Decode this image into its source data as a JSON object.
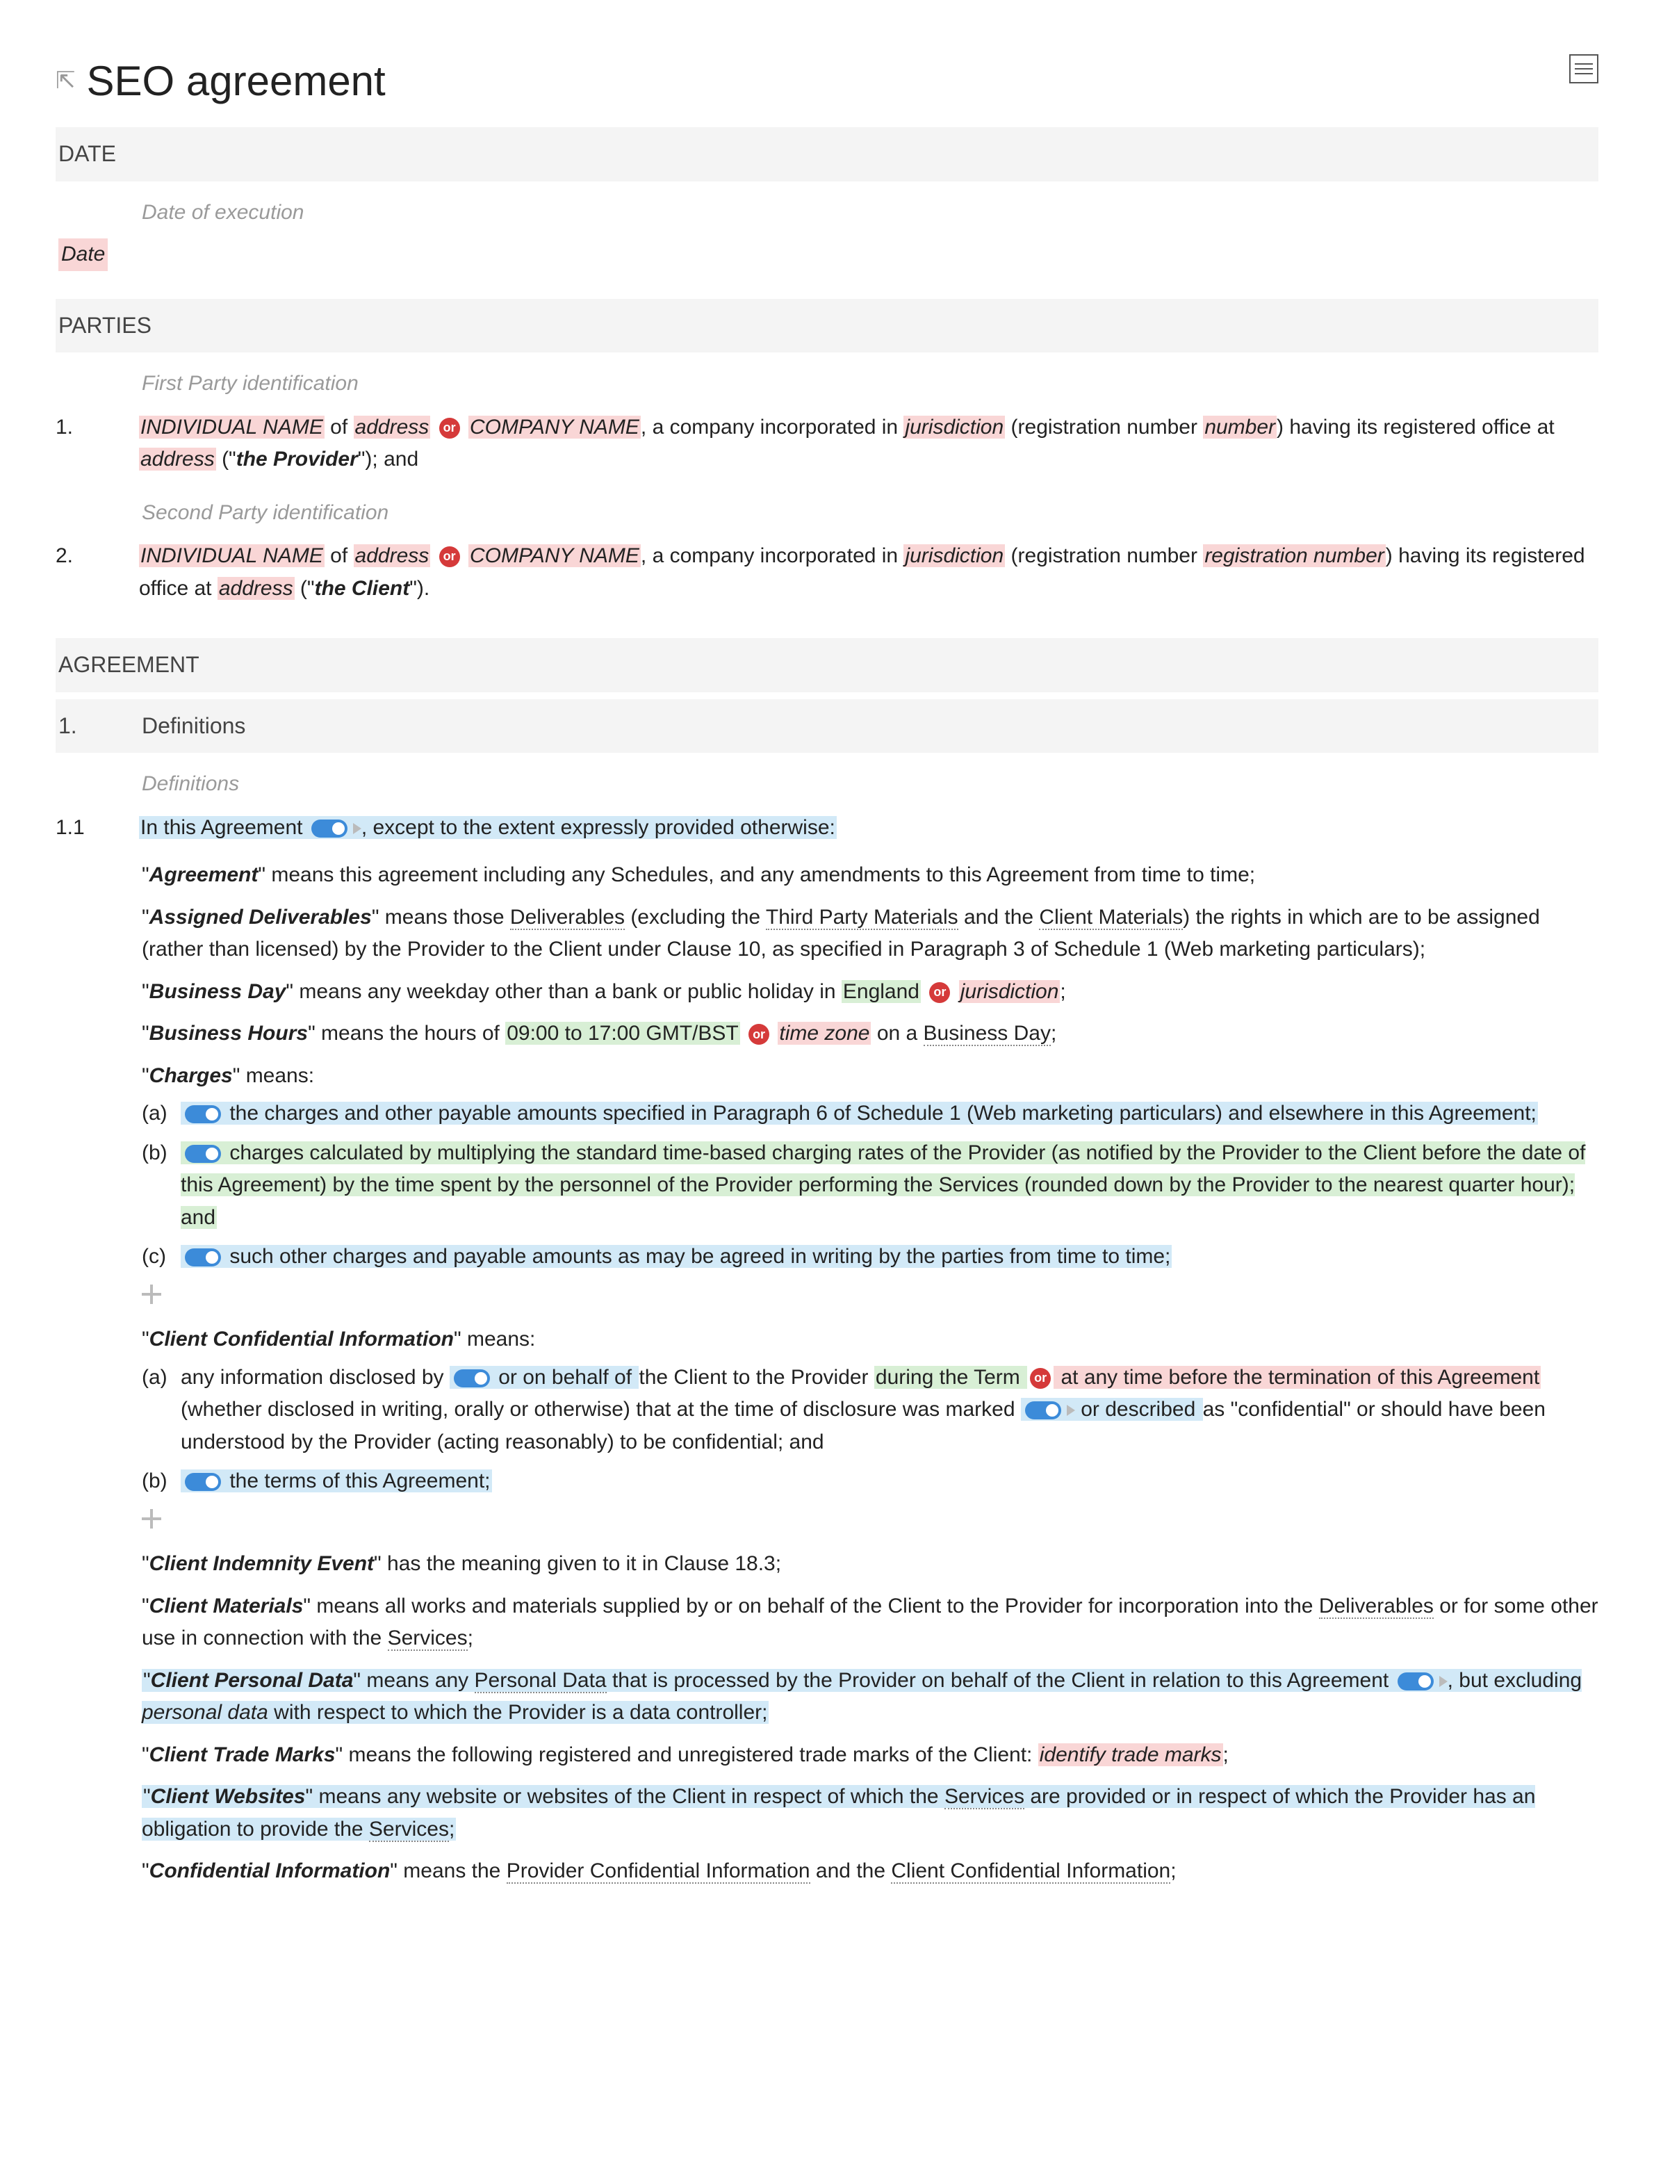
{
  "title": "SEO agreement",
  "sections": {
    "date": {
      "header": "DATE",
      "hint": "Date of execution",
      "value": "Date"
    },
    "parties": {
      "header": "PARTIES",
      "p1_hint": "First Party identification",
      "p2_hint": "Second Party identification",
      "p1_num": "1.",
      "p2_num": "2.",
      "p1": {
        "individual": "INDIVIDUAL NAME",
        "of": " of ",
        "address1": "address",
        "or": "or",
        "company": "COMPANY NAME",
        "inc_text": ", a company incorporated in ",
        "jurisdiction": "jurisdiction",
        "reg_open": " (registration number ",
        "number": "number",
        "reg_close": ") having its registered office at ",
        "address2": "address",
        "def_open": " (\"",
        "def_label": "the Provider",
        "def_close": "\"); and"
      },
      "p2": {
        "individual": "INDIVIDUAL NAME",
        "of": " of ",
        "address1": "address",
        "or": "or",
        "company": "COMPANY NAME",
        "inc_text": ", a company incorporated in ",
        "jurisdiction": "jurisdiction",
        "reg_open": " (registration number ",
        "number": "registration number",
        "reg_close": ") having its registered office at ",
        "address2": "address",
        "def_open": " (\"",
        "def_label": "the Client",
        "def_close": "\")."
      }
    },
    "agreement": {
      "header": "AGREEMENT",
      "s1_num": "1.",
      "s1_title": "Definitions",
      "defs_hint": "Definitions",
      "c11_num": "1.1",
      "c11_lead": "In this Agreement",
      "c11_tail": ", except to the extent expressly provided otherwise:",
      "agreement_def_term": "Agreement",
      "agreement_def_body": "\" means this agreement including any Schedules, and any amendments to this Agreement from time to time;",
      "assigned_term": "Assigned Deliverables",
      "assigned_pre": "\" means those ",
      "assigned_d1": "Deliverables",
      "assigned_mid1": " (excluding the ",
      "assigned_d2": "Third Party Materials",
      "assigned_mid2": " and the ",
      "assigned_d3": "Client Materials",
      "assigned_tail": ") the rights in which are to be assigned (rather than licensed) by the Provider to the Client under Clause 10, as specified in Paragraph 3 of Schedule 1 (Web marketing particulars);",
      "bday_term": "Business Day",
      "bday_body": "\" means any weekday other than a bank or public holiday in ",
      "bday_england": "England",
      "bday_or": "or",
      "bday_juris": "jurisdiction",
      "bday_end": ";",
      "bhours_term": "Business Hours",
      "bhours_body": "\" means the hours of ",
      "bhours_time": "09:00 to 17:00 GMT/BST",
      "bhours_or": "or",
      "bhours_tz": "time zone",
      "bhours_on": " on a ",
      "bhours_bd": "Business Day",
      "bhours_end": ";",
      "charges_term": "Charges",
      "charges_body": "\" means:",
      "charges_a_letter": "(a)",
      "charges_a": "the charges and other payable amounts specified in Paragraph 6 of Schedule 1 (Web marketing particulars) and elsewhere in this Agreement;",
      "charges_b_letter": "(b)",
      "charges_b": "charges calculated by multiplying the standard time-based charging rates of the Provider (as notified by the Provider to the Client before the date of this Agreement) by the time spent by the personnel of the Provider performing the Services (rounded down by the Provider to the nearest quarter hour); and",
      "charges_c_letter": "(c)",
      "charges_c": "such other charges and payable amounts as may be agreed in writing by the parties from time to time;",
      "cci_term": "Client Confidential Information",
      "cci_body": "\" means:",
      "cci_a_letter": "(a)",
      "cci_a_1": "any information disclosed by ",
      "cci_a_2": "or on behalf of ",
      "cci_a_3": "the Client to the Provider ",
      "cci_a_4": "during the Term ",
      "cci_a_or": "or",
      "cci_a_5": " at any time before the termination of this Agreement",
      "cci_a_6": " (whether disclosed in writing, orally or otherwise) that at the time of disclosure was marked ",
      "cci_a_7": "or described ",
      "cci_a_8": "as \"confidential\" or should have been understood by the Provider (acting reasonably) to be confidential; and",
      "cci_b_letter": "(b)",
      "cci_b": "the terms of this Agreement;",
      "cie_term": "Client Indemnity Event",
      "cie_body": "\" has the meaning given to it in Clause 18.3;",
      "cm_term": "Client Materials",
      "cm_body1": "\" means all works and materials supplied by or on behalf of the Client to the Provider for incorporation into the ",
      "cm_d1": "Deliverables",
      "cm_body2": " or for some other use in connection with the ",
      "cm_d2": "Services",
      "cm_end": ";",
      "cpd_term": "Client Personal Data",
      "cpd_body1": "\" means any ",
      "cpd_d1": "Personal Data",
      "cpd_body2": " that is processed by the Provider on behalf of the Client in relation to this Agreement",
      "cpd_body3": ", but excluding ",
      "cpd_pd": "personal data",
      "cpd_body4": " with respect to which the Provider is a data controller;",
      "ctm_term": "Client Trade Marks",
      "ctm_body": "\" means the following registered and unregistered trade marks of the Client: ",
      "ctm_var": "identify trade marks",
      "ctm_end": ";",
      "cw_term": "Client Websites",
      "cw_body1": "\" means any website or websites of the Client in respect of which the ",
      "cw_s1": "Services",
      "cw_body2": " are provided or in respect of which the Provider has an obligation to provide the ",
      "cw_s2": "Services",
      "cw_end": ";",
      "ci_term": "Confidential Information",
      "ci_body": "\" means the ",
      "ci_d1": "Provider Confidential Information",
      "ci_mid": " and the ",
      "ci_d2": "Client Confidential Information",
      "ci_end": ";"
    }
  }
}
